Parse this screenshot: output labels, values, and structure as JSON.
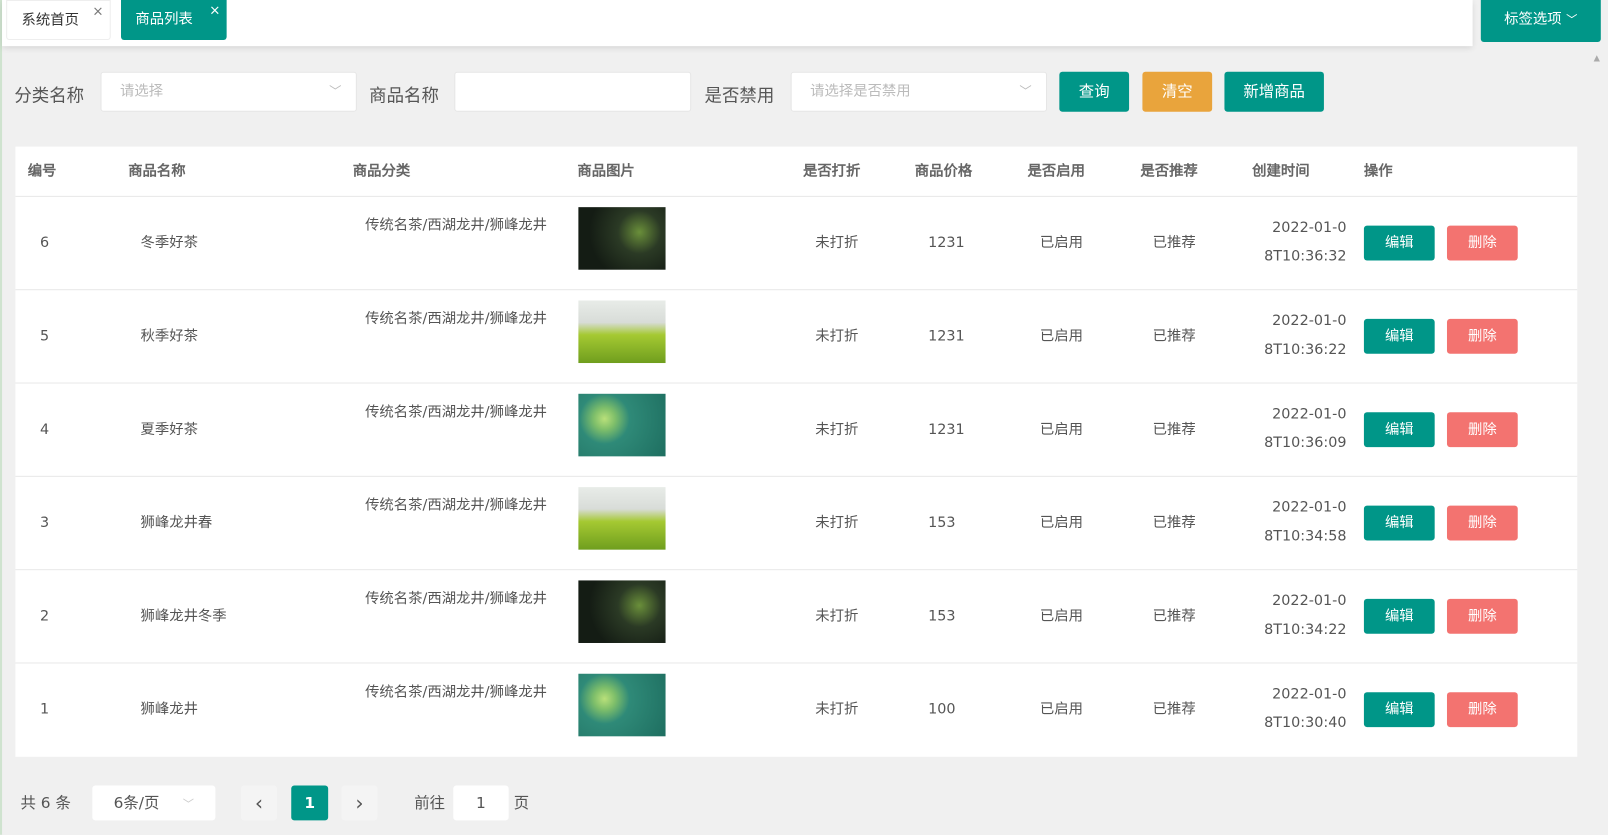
{
  "tabs": [
    {
      "label": "系统首页",
      "close": "×"
    },
    {
      "label": "商品列表",
      "close": "×"
    }
  ],
  "tag_options": {
    "label": "标签选项",
    "icon": "chevron-down-icon"
  },
  "filters": {
    "category_label": "分类名称",
    "category_placeholder": "请选择",
    "name_label": "商品名称",
    "name_value": "",
    "disabled_label": "是否禁用",
    "disabled_placeholder": "请选择是否禁用",
    "query": "查询",
    "clear": "清空",
    "add": "新增商品"
  },
  "colors": {
    "primary": "#009688",
    "warning": "#e9a43c",
    "danger": "#f37370"
  },
  "table": {
    "headers": [
      "编号",
      "商品名称",
      "商品分类",
      "商品图片",
      "是否打折",
      "商品价格",
      "是否启用",
      "是否推荐",
      "创建时间",
      "操作"
    ],
    "rows": [
      {
        "id": "6",
        "name": "冬季好茶",
        "category": "传统名茶/西湖龙井/狮峰龙井",
        "discount": "未打折",
        "price": "1231",
        "enabled": "已启用",
        "recommend": "已推荐",
        "time1": "2022-01-0",
        "time2": "8T10:36:32",
        "img": "0"
      },
      {
        "id": "5",
        "name": "秋季好茶",
        "category": "传统名茶/西湖龙井/狮峰龙井",
        "discount": "未打折",
        "price": "1231",
        "enabled": "已启用",
        "recommend": "已推荐",
        "time1": "2022-01-0",
        "time2": "8T10:36:22",
        "img": "1"
      },
      {
        "id": "4",
        "name": "夏季好茶",
        "category": "传统名茶/西湖龙井/狮峰龙井",
        "discount": "未打折",
        "price": "1231",
        "enabled": "已启用",
        "recommend": "已推荐",
        "time1": "2022-01-0",
        "time2": "8T10:36:09",
        "img": "2"
      },
      {
        "id": "3",
        "name": "狮峰龙井春",
        "category": "传统名茶/西湖龙井/狮峰龙井",
        "discount": "未打折",
        "price": "153",
        "enabled": "已启用",
        "recommend": "已推荐",
        "time1": "2022-01-0",
        "time2": "8T10:34:58",
        "img": "1"
      },
      {
        "id": "2",
        "name": "狮峰龙井冬季",
        "category": "传统名茶/西湖龙井/狮峰龙井",
        "discount": "未打折",
        "price": "153",
        "enabled": "已启用",
        "recommend": "已推荐",
        "time1": "2022-01-0",
        "time2": "8T10:34:22",
        "img": "0"
      },
      {
        "id": "1",
        "name": "狮峰龙井",
        "category": "传统名茶/西湖龙井/狮峰龙井",
        "discount": "未打折",
        "price": "100",
        "enabled": "已启用",
        "recommend": "已推荐",
        "time1": "2022-01-0",
        "time2": "8T10:30:40",
        "img": "2"
      }
    ],
    "edit": "编辑",
    "delete": "删除"
  },
  "pagination": {
    "total": "共 6 条",
    "page_size": "6条/页",
    "prev": "‹",
    "current": "1",
    "next": "›",
    "goto_label": "前往",
    "goto_value": "1",
    "goto_suffix": "页"
  }
}
